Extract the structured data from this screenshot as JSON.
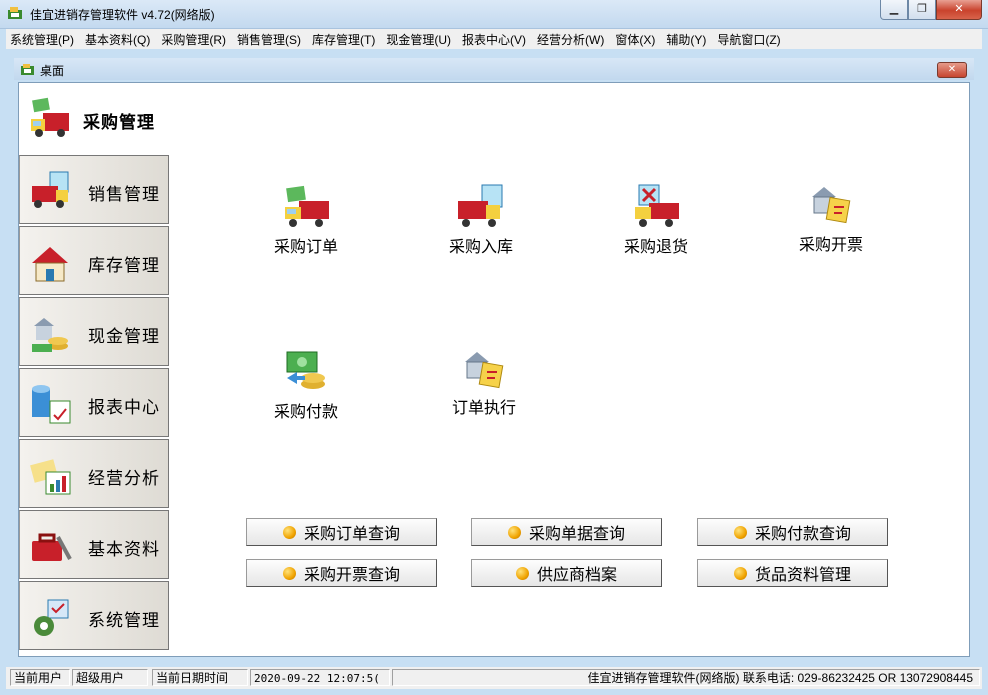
{
  "window": {
    "title": "佳宜进销存管理软件 v4.72(网络版)"
  },
  "menu": [
    "系统管理(P)",
    "基本资料(Q)",
    "采购管理(R)",
    "销售管理(S)",
    "库存管理(T)",
    "现金管理(U)",
    "报表中心(V)",
    "经营分析(W)",
    "窗体(X)",
    "辅助(Y)",
    "导航窗口(Z)"
  ],
  "desktop": {
    "title": "桌面"
  },
  "sidebar": {
    "active": "采购管理",
    "items": [
      "销售管理",
      "库存管理",
      "现金管理",
      "报表中心",
      "经营分析",
      "基本资料",
      "系统管理"
    ]
  },
  "functions": [
    "采购订单",
    "采购入库",
    "采购退货",
    "采购开票",
    "采购付款",
    "订单执行"
  ],
  "quick_buttons": [
    "采购订单查询",
    "采购单据查询",
    "采购付款查询",
    "采购开票查询",
    "供应商档案",
    "货品资料管理"
  ],
  "status": {
    "user_label": "当前用户",
    "user_value": "超级用户",
    "datetime_label": "当前日期时间",
    "datetime_value": "2020-09-22 12:07:5(",
    "info": "佳宜进销存管理软件(网络版) 联系电话: 029-86232425 OR 13072908445"
  },
  "colors": {
    "bullet": "#f0a300",
    "truck": "#c8202a",
    "chrome": "#c7dff3"
  }
}
